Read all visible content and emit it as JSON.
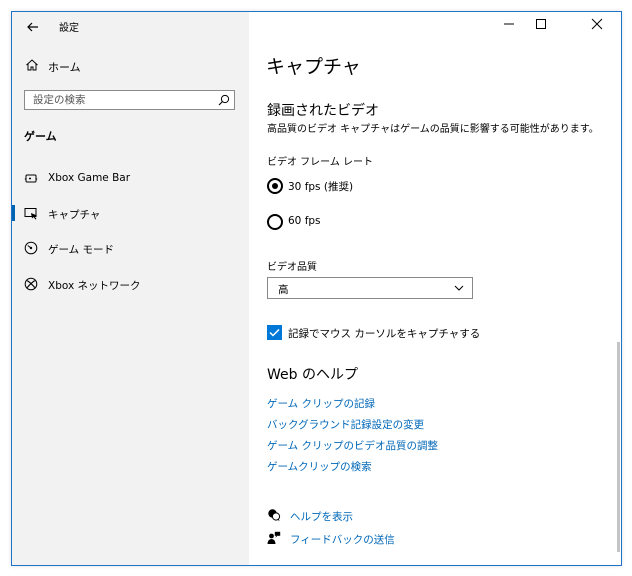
{
  "window": {
    "title": "設定"
  },
  "sidebar": {
    "home_label": "ホーム",
    "search_placeholder": "設定の検索",
    "section_header": "ゲーム",
    "items": [
      {
        "label": "Xbox Game Bar",
        "icon": "xbox-game-bar-icon",
        "selected": false
      },
      {
        "label": "キャプチャ",
        "icon": "capture-icon",
        "selected": true
      },
      {
        "label": "ゲーム モード",
        "icon": "game-mode-icon",
        "selected": false
      },
      {
        "label": "Xbox ネットワーク",
        "icon": "xbox-icon",
        "selected": false
      }
    ]
  },
  "main": {
    "page_title": "キャプチャ",
    "section_title": "録画されたビデオ",
    "description": "高品質のビデオ キャプチャはゲームの品質に影響する可能性があります。",
    "frame_rate": {
      "label": "ビデオ フレーム レート",
      "options": [
        {
          "label": "30 fps (推奨)",
          "selected": true
        },
        {
          "label": "60 fps",
          "selected": false
        }
      ]
    },
    "quality": {
      "label": "ビデオ品質",
      "value": "高"
    },
    "capture_cursor": {
      "label": "記録でマウス カーソルをキャプチャする",
      "checked": true
    },
    "help": {
      "title": "Web のヘルプ",
      "links": [
        "ゲーム クリップの記録",
        "バックグラウンド記録設定の変更",
        "ゲーム クリップのビデオ品質の調整",
        "ゲームクリップの検索"
      ]
    },
    "get_help_label": "ヘルプを表示",
    "feedback_label": "フィードバックの送信"
  },
  "colors": {
    "accent": "#0078d7",
    "link": "#0067b8",
    "sidebar_bg": "#f2f2f2",
    "window_border": "#1f73c9"
  }
}
